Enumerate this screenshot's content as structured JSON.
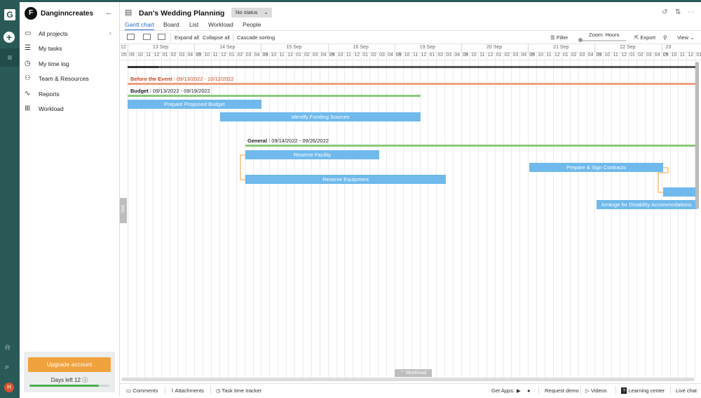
{
  "app": {
    "workspace_initial": "F",
    "workspace_name": "Danginncreates",
    "rail_logo": "G",
    "avatar_initial": "H"
  },
  "sidebar": {
    "items": [
      {
        "label": "All projects",
        "icon": "folder-icon"
      },
      {
        "label": "My tasks",
        "icon": "checklist-icon"
      },
      {
        "label": "My time log",
        "icon": "clock-icon"
      },
      {
        "label": "Team & Resources",
        "icon": "team-icon"
      },
      {
        "label": "Reports",
        "icon": "chart-icon"
      },
      {
        "label": "Workload",
        "icon": "grid-icon"
      }
    ],
    "upgrade_label": "Upgrade account",
    "days_left": "Days left 12",
    "days_progress": 0.87
  },
  "header": {
    "title": "Dan's Wedding Planning",
    "status": "No status",
    "tabs": [
      "Gantt chart",
      "Board",
      "List",
      "Workload",
      "People"
    ],
    "active_tab": "Gantt chart"
  },
  "toolbar": {
    "expand_all": "Expand all",
    "collapse_all": "Collapse all",
    "cascade_sorting": "Cascade sorting",
    "filter": "Filter",
    "zoom": "Zoom: Hours",
    "export": "Export",
    "view": "View"
  },
  "timeline": {
    "first_partial_day": "12",
    "first_partial_hour": "05",
    "days": [
      "13 Sep",
      "14 Sep",
      "15 Sep",
      "16 Sep",
      "19 Sep",
      "20 Sep",
      "21 Sep",
      "22 Sep",
      "23"
    ],
    "hours_per_day": [
      "09",
      "10",
      "11",
      "12",
      "01",
      "02",
      "03",
      "04",
      "05"
    ]
  },
  "groups": [
    {
      "name": "Before the Event",
      "dates": "09/13/2022 - 10/12/2022",
      "color": "#f0a082",
      "label_color": "#c8451f"
    },
    {
      "name": "Budget",
      "dates": "09/13/2022 - 09/19/2022",
      "color": "#8bc97c",
      "label_color": "#222222"
    },
    {
      "name": "General",
      "dates": "09/14/2022 - 09/26/2022",
      "color": "#8bc97c",
      "label_color": "#222222"
    }
  ],
  "tasks": [
    {
      "label": "Prepare Proposed Budget"
    },
    {
      "label": "Identify Funding Sources"
    },
    {
      "label": "Reserve Facility"
    },
    {
      "label": "Reserve Equipment"
    },
    {
      "label": "Prepare & Sign Contracts"
    },
    {
      "label": ""
    },
    {
      "label": "Arrange for Disability Accommodations"
    }
  ],
  "panels": {
    "grid_handle": "Grid",
    "workload_tab": "Workload"
  },
  "footer": {
    "comments": "Comments",
    "attachments": "Attachments",
    "time_tracker": "Task time tracker",
    "get_apps": "Get Apps:",
    "request_demo": "Request demo",
    "videos": "Videos",
    "learning_center": "Learning center",
    "live_chat": "Live chat"
  },
  "colors": {
    "rail": "#2a5a57",
    "accent": "#2a6cc6",
    "task_bar": "#6fb9ec",
    "upgrade": "#f0a23d",
    "dependency": "#f0a23d"
  }
}
